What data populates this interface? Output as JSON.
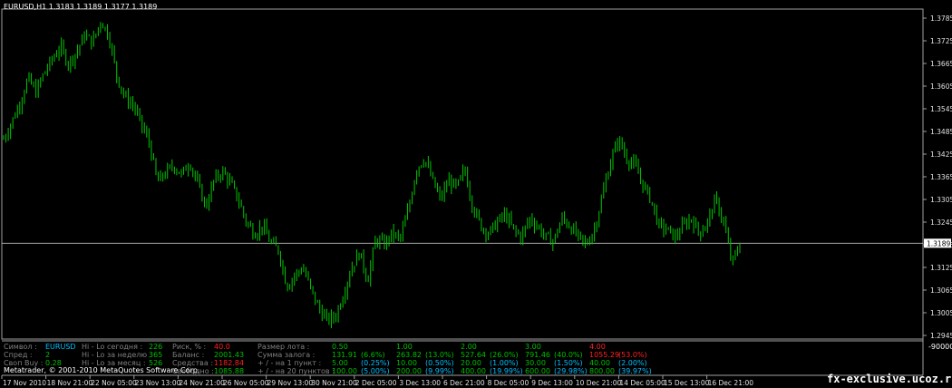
{
  "header": {
    "title": "EURUSD,H1  1.3183 1.3189 1.3177 1.3189"
  },
  "colors": {
    "background": "#000000",
    "candle": "#00c800",
    "axis": "#c0c0c0",
    "label": "#808080",
    "symbol": "#00bfff",
    "value": "#00c000",
    "warn": "#ff2020"
  },
  "price_axis": {
    "ticks": [
      "1.3785",
      "1.3725",
      "1.3665",
      "1.3605",
      "1.3545",
      "1.3485",
      "1.3425",
      "1.3365",
      "1.3305",
      "1.3245",
      "1.3185",
      "1.3125",
      "1.3065",
      "1.3005",
      "1.2945"
    ],
    "current": "1.3189"
  },
  "time_axis": {
    "ticks": [
      "17 Nov 2010",
      "18 Nov 21:00",
      "22 Nov 05:00",
      "23 Nov 13:00",
      "24 Nov 21:00",
      "26 Nov 05:00",
      "29 Nov 13:00",
      "30 Nov 21:00",
      "2 Dec 05:00",
      "3 Dec 13:00",
      "6 Dec 21:00",
      "8 Dec 05:00",
      "9 Dec 13:00",
      "10 Dec 21:00",
      "14 Dec 05:00",
      "15 Dec 13:00",
      "16 Dec 21:00"
    ]
  },
  "chart_data": {
    "type": "line",
    "x_range": [
      "17 Nov 2010",
      "16 Dec 21:00"
    ],
    "ylim": [
      1.2945,
      1.3785
    ],
    "current_price": 1.3189,
    "series": [
      {
        "values": [
          1.3465,
          1.351,
          1.356,
          1.3625,
          1.359,
          1.364,
          1.3675,
          1.371,
          1.3665,
          1.3695,
          1.374,
          1.372,
          1.3778,
          1.374,
          1.363,
          1.3575,
          1.3555,
          1.3505,
          1.3455,
          1.335,
          1.3375,
          1.3395,
          1.337,
          1.3405,
          1.3345,
          1.3285,
          1.3355,
          1.338,
          1.335,
          1.3305,
          1.3245,
          1.3215,
          1.3235,
          1.319,
          1.317,
          1.3075,
          1.3105,
          1.3125,
          1.3065,
          1.3015,
          1.2985,
          1.2995,
          1.3055,
          1.3125,
          1.3165,
          1.309,
          1.32,
          1.3185,
          1.3215,
          1.32,
          1.3275,
          1.3385,
          1.3415,
          1.3355,
          1.3305,
          1.3355,
          1.3335,
          1.3385,
          1.3285,
          1.3235,
          1.3215,
          1.3245,
          1.3265,
          1.3225,
          1.3205,
          1.3255,
          1.3235,
          1.3205,
          1.3195,
          1.3255,
          1.3235,
          1.3205,
          1.3185,
          1.3225,
          1.3315,
          1.3405,
          1.3465,
          1.3415,
          1.3395,
          1.3345,
          1.3305,
          1.3235,
          1.3225,
          1.3205,
          1.3235,
          1.3255,
          1.3215,
          1.3245,
          1.3305,
          1.3245,
          1.3135,
          1.3185
        ]
      }
    ]
  },
  "panel": {
    "scale": "-900000",
    "col1": {
      "labels": [
        "Символ :",
        "Спред :",
        "Своп Buy :"
      ],
      "values": [
        "EURUSD",
        "2",
        "0.28"
      ]
    },
    "col2": {
      "labels": [
        "Hi - Lo сегодня :",
        "Hi - Lo за неделю :",
        "Hi - Lo за месяц :"
      ],
      "values": [
        "226",
        "365",
        "526"
      ]
    },
    "col3": {
      "labels": [
        "Риск, % :",
        "Баланс :",
        "Средства :",
        "Свободно :"
      ],
      "values": [
        "40.0",
        "2001.43",
        "1182.84",
        "1085.88"
      ]
    },
    "col4": {
      "labels": [
        "Размер лота :",
        "Сумма залога :",
        "+ / -  на 1 пункт :",
        "+ / -  на 20 пунктов :"
      ]
    },
    "lots": [
      {
        "lot": "0.50",
        "margin": "131.91",
        "margin_pct": "(6.6%)",
        "pt": "5.00",
        "pt_pct": "(0.25%)",
        "pt20": "100.00",
        "pt20_pct": "(5.00%)"
      },
      {
        "lot": "1.00",
        "margin": "263.82",
        "margin_pct": "(13.0%)",
        "pt": "10.00",
        "pt_pct": "(0.50%)",
        "pt20": "200.00",
        "pt20_pct": "(9.99%)"
      },
      {
        "lot": "2.00",
        "margin": "527.64",
        "margin_pct": "(26.0%)",
        "pt": "20.00",
        "pt_pct": "(1.00%)",
        "pt20": "400.00",
        "pt20_pct": "(19.99%)"
      },
      {
        "lot": "3.00",
        "margin": "791.46",
        "margin_pct": "(40.0%)",
        "pt": "30.00",
        "pt_pct": "(1.50%)",
        "pt20": "600.00",
        "pt20_pct": "(29.98%)"
      },
      {
        "lot": "4.00",
        "margin": "1055.29",
        "margin_pct": "(53.0%)",
        "pt": "40.00",
        "pt_pct": "(2.00%)",
        "pt20": "800.00",
        "pt20_pct": "(39.97%)"
      }
    ]
  },
  "footer": {
    "copyright": "Metatrader, © 2001-2010 MetaQuotes Software Corp.",
    "watermark": "fx-exclusive.ucoz.ru"
  }
}
